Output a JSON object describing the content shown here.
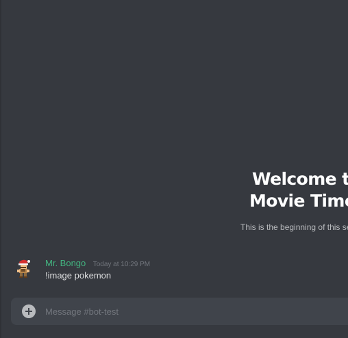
{
  "welcome": {
    "title_line1": "Welcome to",
    "title_line2": "Movie Time",
    "subtitle": "This is the beginning of this se"
  },
  "messages": [
    {
      "username": "Mr. Bongo",
      "timestamp": "Today at 10:29 PM",
      "content": "!image pokemon",
      "username_color": "#43b581",
      "avatar": "mario-avatar-icon"
    }
  ],
  "composer": {
    "placeholder": "Message #bot-test",
    "value": "",
    "attach_icon": "plus-circle-icon"
  },
  "colors": {
    "background": "#36393f",
    "composer_background": "#40444b",
    "muted_text": "#72767d",
    "text": "#dcddde",
    "heading": "#ffffff"
  }
}
